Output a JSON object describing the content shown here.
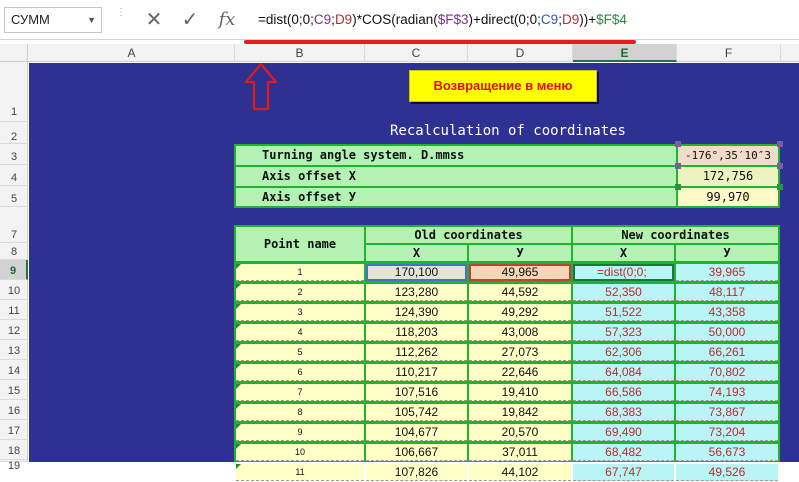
{
  "formula_bar": {
    "name_box": "СУММ",
    "cancel_icon": "✕",
    "enter_icon": "✓",
    "fx_label": "fx",
    "formula": {
      "p1": "=dist(0;0;",
      "p2": "C9",
      "p3": ";",
      "p4": "D9",
      "p5": ")*COS(radian(",
      "p6": "$F$3",
      "p7": ")+direct(0;0;",
      "p8": "C9",
      "p9": ";",
      "p10": "D9",
      "p11": "))+",
      "p12": "$F$4"
    }
  },
  "columns": [
    "A",
    "B",
    "C",
    "D",
    "E",
    "F"
  ],
  "rows": [
    "1",
    "2",
    "3",
    "4",
    "5",
    "7",
    "8",
    "9",
    "10",
    "11",
    "12",
    "13",
    "14",
    "15",
    "16",
    "17",
    "18",
    "19"
  ],
  "menu_button": "Возвращение в меню",
  "title": "Recalculation of coordinates",
  "params": [
    {
      "label": "Turning angle system. D.mmss",
      "value": "-176°,35′10″3"
    },
    {
      "label": "Axis offset X",
      "value": "172,756"
    },
    {
      "label": "Axis offset У",
      "value": "99,970"
    }
  ],
  "table": {
    "point_header": "Point name",
    "old_header": "Old coordinates",
    "new_header": "New coordinates",
    "x_label": "X",
    "y_label": "У",
    "rows": [
      {
        "n": "1",
        "ox": "170,100",
        "oy": "49,965",
        "nx": "=dist(0;0;",
        "ny": "39,965"
      },
      {
        "n": "2",
        "ox": "123,280",
        "oy": "44,592",
        "nx": "52,350",
        "ny": "48,117"
      },
      {
        "n": "3",
        "ox": "124,390",
        "oy": "49,292",
        "nx": "51,522",
        "ny": "43,358"
      },
      {
        "n": "4",
        "ox": "118,203",
        "oy": "43,008",
        "nx": "57,323",
        "ny": "50,000"
      },
      {
        "n": "5",
        "ox": "112,262",
        "oy": "27,073",
        "nx": "62,306",
        "ny": "66,261"
      },
      {
        "n": "6",
        "ox": "110,217",
        "oy": "22,646",
        "nx": "64,084",
        "ny": "70,802"
      },
      {
        "n": "7",
        "ox": "107,516",
        "oy": "19,410",
        "nx": "66,586",
        "ny": "74,193"
      },
      {
        "n": "8",
        "ox": "105,742",
        "oy": "19,842",
        "nx": "68,383",
        "ny": "73,867"
      },
      {
        "n": "9",
        "ox": "104,677",
        "oy": "20,570",
        "nx": "69,490",
        "ny": "73,204"
      },
      {
        "n": "10",
        "ox": "106,667",
        "oy": "37,011",
        "nx": "68,482",
        "ny": "56,673"
      },
      {
        "n": "11",
        "ox": "107,826",
        "oy": "44,102",
        "nx": "67,747",
        "ny": "49,526"
      }
    ]
  },
  "colors": {
    "sheet_bg": "#2e3192",
    "table_green": "#21b32d",
    "menu_yellow": "#ffff00",
    "new_value_red": "#c0282d"
  }
}
